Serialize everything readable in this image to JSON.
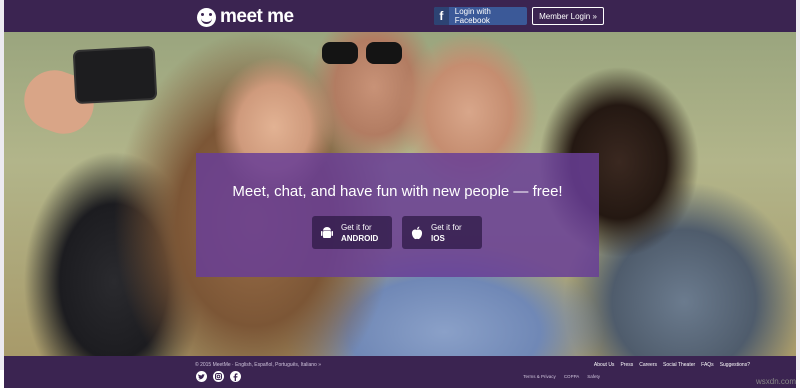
{
  "header": {
    "logo_text": "meet me",
    "facebook_login": "Login with Facebook",
    "facebook_letter": "f",
    "member_login": "Member Login »"
  },
  "hero": {
    "headline": "Meet, chat, and have fun with new people — free!",
    "android": {
      "line1": "Get it for",
      "line2": "ANDROID"
    },
    "ios": {
      "line1": "Get it for",
      "line2": "IOS"
    }
  },
  "footer": {
    "copyright": "© 2015 MeetMe · English, Español, Português, Italiano »",
    "nav_links": [
      "About Us",
      "Press",
      "Careers",
      "Social Theater",
      "FAQs",
      "Suggestions?"
    ],
    "legal_links": [
      "Terms & Privacy",
      "COPPA",
      "Safety"
    ],
    "social_icons": [
      "twitter-icon",
      "instagram-icon",
      "facebook-icon"
    ]
  },
  "watermark": "wsxdn.com",
  "colors": {
    "brand_purple": "#3b2451",
    "cta_purple": "#683e96",
    "facebook_blue": "#3b5998"
  }
}
